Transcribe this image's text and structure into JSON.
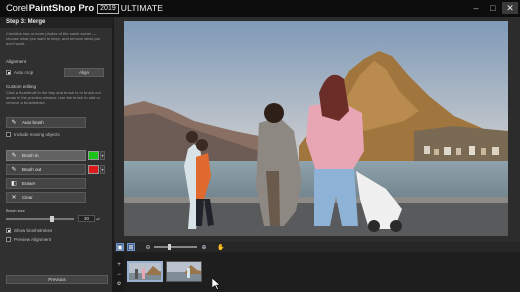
{
  "app": {
    "brand_corel": "Corel",
    "brand_product": "PaintShop Pro",
    "brand_year": "2019",
    "brand_edition": "ULTIMATE"
  },
  "window_controls": {
    "minimize": "–",
    "restore": "□",
    "close": "✕"
  },
  "panel": {
    "step_title": "Step 3: Merge",
    "intro": "Combine two or more photos of the same scene — choose what you want to keep, and remove what you don't want.",
    "alignment": {
      "label": "Alignment",
      "auto_crop_label": "Auto crop",
      "auto_crop_checked": true,
      "align_button": "Align"
    },
    "custom_editing": {
      "label": "Custom editing",
      "instructions": "Click a thumbnail in the tray and brush in or brush out areas in the preview window. Use the brush to add or remove a brushstroke.",
      "auto_brush_button": "Auto brush",
      "include_moving_label": "Include moving objects",
      "include_moving_checked": false
    },
    "tools": {
      "brush_in": {
        "label": "Brush in",
        "color": "#19c319"
      },
      "brush_out": {
        "label": "Brush out",
        "color": "#dd1a1a"
      },
      "eraser": {
        "label": "Eraser"
      },
      "clear": {
        "label": "Clear"
      },
      "dropdown_glyph": "▾"
    },
    "brush_size": {
      "label": "Brush size",
      "value": "30",
      "level": 0.68
    },
    "show_brushstrokes_label": "Show brushstrokes",
    "show_brushstrokes_checked": true,
    "preview_alignment_label": "Preview Alignment",
    "preview_alignment_checked": false,
    "previous_button": "Previous"
  },
  "toolbar": {
    "icons": [
      "fit-view-icon",
      "actual-size-icon",
      "zoom-out-icon",
      "zoom-in-icon",
      "pan-icon"
    ],
    "zoom_level": 0.35
  },
  "tray": {
    "add_glyph": "+",
    "remove_glyph": "−",
    "thumbnails_count": 2,
    "selected_index": 0
  }
}
